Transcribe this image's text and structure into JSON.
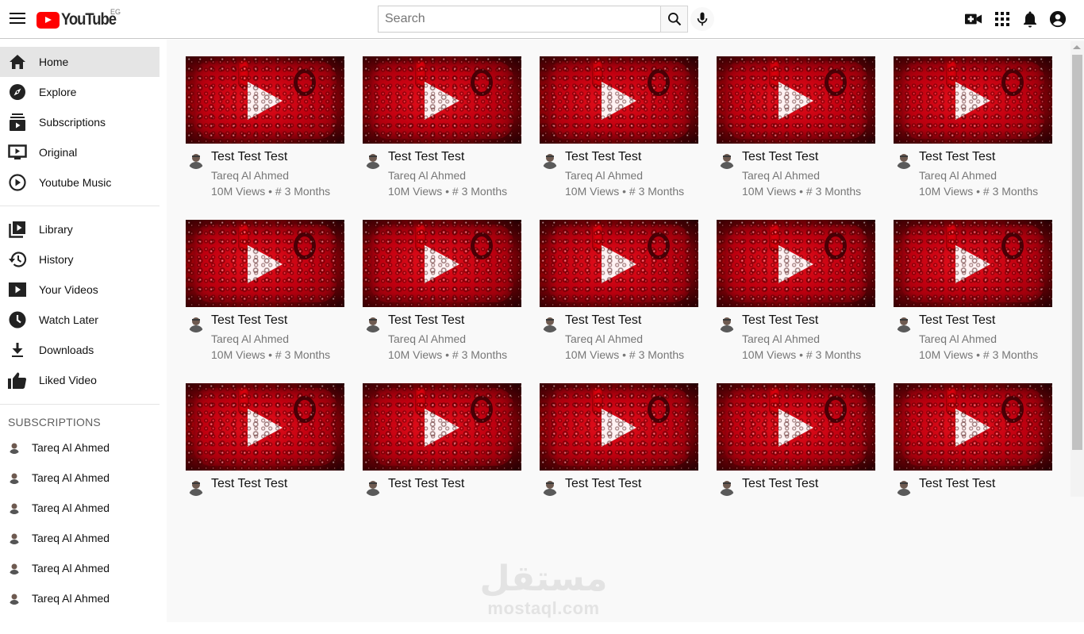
{
  "header": {
    "logo_text": "YouTube",
    "country_code": "EG",
    "search_placeholder": "Search",
    "icons": [
      "menu-icon",
      "search-icon",
      "mic-icon",
      "create-video-icon",
      "apps-icon",
      "notifications-icon",
      "account-icon"
    ]
  },
  "sidebar": {
    "main_items": [
      {
        "label": "Home",
        "icon": "home-icon",
        "active": true
      },
      {
        "label": "Explore",
        "icon": "compass-icon"
      },
      {
        "label": "Subscriptions",
        "icon": "subscriptions-icon"
      },
      {
        "label": "Original",
        "icon": "originals-icon"
      },
      {
        "label": "Youtube Music",
        "icon": "play-circle-icon"
      }
    ],
    "library_items": [
      {
        "label": "Library",
        "icon": "library-icon"
      },
      {
        "label": "History",
        "icon": "history-icon"
      },
      {
        "label": "Your Videos",
        "icon": "your-videos-icon"
      },
      {
        "label": "Watch Later",
        "icon": "clock-icon"
      },
      {
        "label": "Downloads",
        "icon": "download-icon"
      },
      {
        "label": "Liked Video",
        "icon": "thumbs-up-icon"
      }
    ],
    "subscriptions_title": "SUBSCRIPTIONS",
    "subscriptions": [
      {
        "name": "Tareq Al Ahmed"
      },
      {
        "name": "Tareq Al Ahmed"
      },
      {
        "name": "Tareq Al Ahmed"
      },
      {
        "name": "Tareq Al Ahmed"
      },
      {
        "name": "Tareq Al Ahmed"
      },
      {
        "name": "Tareq Al Ahmed"
      }
    ]
  },
  "videos": [
    {
      "title": "Test Test Test",
      "channel": "Tareq Al Ahmed",
      "meta": "10M Views • # 3 Months"
    },
    {
      "title": "Test Test Test",
      "channel": "Tareq Al Ahmed",
      "meta": "10M Views • # 3 Months"
    },
    {
      "title": "Test Test Test",
      "channel": "Tareq Al Ahmed",
      "meta": "10M Views • # 3 Months"
    },
    {
      "title": "Test Test Test",
      "channel": "Tareq Al Ahmed",
      "meta": "10M Views • # 3 Months"
    },
    {
      "title": "Test Test Test",
      "channel": "Tareq Al Ahmed",
      "meta": "10M Views • # 3 Months"
    },
    {
      "title": "Test Test Test",
      "channel": "Tareq Al Ahmed",
      "meta": "10M Views • # 3 Months"
    },
    {
      "title": "Test Test Test",
      "channel": "Tareq Al Ahmed",
      "meta": "10M Views • # 3 Months"
    },
    {
      "title": "Test Test Test",
      "channel": "Tareq Al Ahmed",
      "meta": "10M Views • # 3 Months"
    },
    {
      "title": "Test Test Test",
      "channel": "Tareq Al Ahmed",
      "meta": "10M Views • # 3 Months"
    },
    {
      "title": "Test Test Test",
      "channel": "Tareq Al Ahmed",
      "meta": "10M Views • # 3 Months"
    },
    {
      "title": "Test Test Test"
    },
    {
      "title": "Test Test Test"
    },
    {
      "title": "Test Test Test"
    },
    {
      "title": "Test Test Test"
    },
    {
      "title": "Test Test Test"
    }
  ],
  "watermark": {
    "arabic": "مستقل",
    "latin": "mostaql.com"
  },
  "colors": {
    "brand_red": "#ff0000",
    "active_bg": "#e5e5e5",
    "secondary_text": "#777777"
  }
}
